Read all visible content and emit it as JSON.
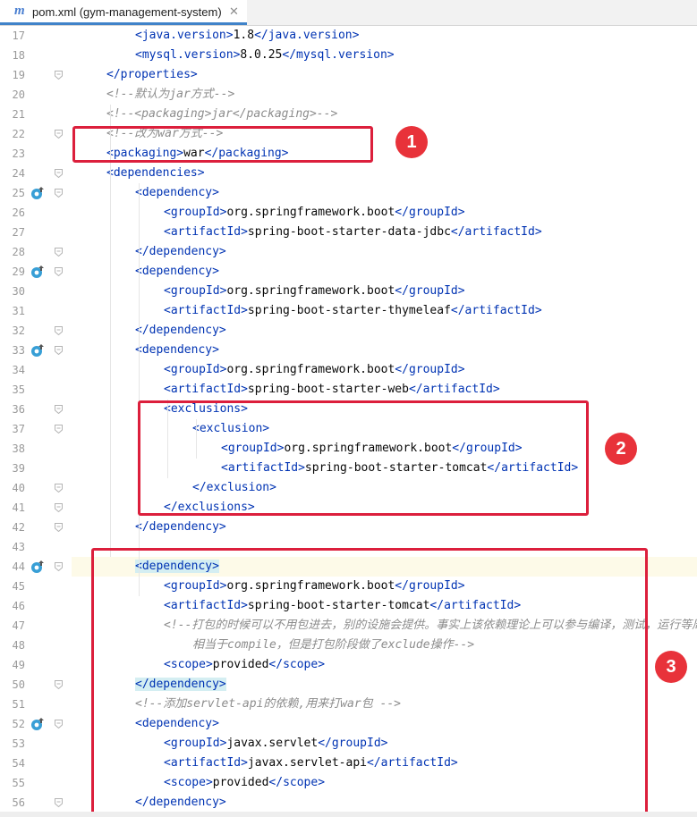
{
  "editor": {
    "tab": {
      "icon": "maven-m-icon",
      "icon_text": "m",
      "label": "pom.xml (gym-management-system)",
      "close": "✕"
    }
  },
  "lines": [
    {
      "no": "17",
      "indent": 2,
      "parts": [
        [
          "t",
          "<java.version>"
        ],
        [
          "x",
          "1.8"
        ],
        [
          "t",
          "</java.version>"
        ]
      ]
    },
    {
      "no": "18",
      "indent": 2,
      "parts": [
        [
          "t",
          "<mysql.version>"
        ],
        [
          "x",
          "8.0.25"
        ],
        [
          "t",
          "</mysql.version>"
        ]
      ]
    },
    {
      "no": "19",
      "indent": 1,
      "parts": [
        [
          "t",
          "</properties>"
        ]
      ]
    },
    {
      "no": "20",
      "indent": 1,
      "parts": [
        [
          "c",
          "<!--默认为jar方式-->"
        ]
      ]
    },
    {
      "no": "21",
      "indent": 1,
      "parts": [
        [
          "c",
          "<!--<packaging>jar</packaging>-->"
        ]
      ]
    },
    {
      "no": "22",
      "indent": 1,
      "parts": [
        [
          "c",
          "<!--改为war方式-->"
        ]
      ]
    },
    {
      "no": "23",
      "indent": 1,
      "parts": [
        [
          "t",
          "<packaging>"
        ],
        [
          "x",
          "war"
        ],
        [
          "t",
          "</packaging>"
        ]
      ]
    },
    {
      "no": "24",
      "indent": 1,
      "parts": [
        [
          "t",
          "<dependencies>"
        ]
      ]
    },
    {
      "no": "25",
      "indent": 2,
      "parts": [
        [
          "t",
          "<dependency>"
        ]
      ]
    },
    {
      "no": "26",
      "indent": 3,
      "parts": [
        [
          "t",
          "<groupId>"
        ],
        [
          "x",
          "org.springframework.boot"
        ],
        [
          "t",
          "</groupId>"
        ]
      ]
    },
    {
      "no": "27",
      "indent": 3,
      "parts": [
        [
          "t",
          "<artifactId>"
        ],
        [
          "x",
          "spring-boot-starter-data-jdbc"
        ],
        [
          "t",
          "</artifactId>"
        ]
      ]
    },
    {
      "no": "28",
      "indent": 2,
      "parts": [
        [
          "t",
          "</dependency>"
        ]
      ]
    },
    {
      "no": "29",
      "indent": 2,
      "parts": [
        [
          "t",
          "<dependency>"
        ]
      ]
    },
    {
      "no": "30",
      "indent": 3,
      "parts": [
        [
          "t",
          "<groupId>"
        ],
        [
          "x",
          "org.springframework.boot"
        ],
        [
          "t",
          "</groupId>"
        ]
      ]
    },
    {
      "no": "31",
      "indent": 3,
      "parts": [
        [
          "t",
          "<artifactId>"
        ],
        [
          "x",
          "spring-boot-starter-thymeleaf"
        ],
        [
          "t",
          "</artifactId>"
        ]
      ]
    },
    {
      "no": "32",
      "indent": 2,
      "parts": [
        [
          "t",
          "</dependency>"
        ]
      ]
    },
    {
      "no": "33",
      "indent": 2,
      "parts": [
        [
          "t",
          "<dependency>"
        ]
      ]
    },
    {
      "no": "34",
      "indent": 3,
      "parts": [
        [
          "t",
          "<groupId>"
        ],
        [
          "x",
          "org.springframework.boot"
        ],
        [
          "t",
          "</groupId>"
        ]
      ]
    },
    {
      "no": "35",
      "indent": 3,
      "parts": [
        [
          "t",
          "<artifactId>"
        ],
        [
          "x",
          "spring-boot-starter-web"
        ],
        [
          "t",
          "</artifactId>"
        ]
      ]
    },
    {
      "no": "36",
      "indent": 3,
      "parts": [
        [
          "t",
          "<exclusions>"
        ]
      ]
    },
    {
      "no": "37",
      "indent": 4,
      "parts": [
        [
          "t",
          "<exclusion>"
        ]
      ]
    },
    {
      "no": "38",
      "indent": 5,
      "parts": [
        [
          "t",
          "<groupId>"
        ],
        [
          "x",
          "org.springframework.boot"
        ],
        [
          "t",
          "</groupId>"
        ]
      ]
    },
    {
      "no": "39",
      "indent": 5,
      "parts": [
        [
          "t",
          "<artifactId>"
        ],
        [
          "x",
          "spring-boot-starter-tomcat"
        ],
        [
          "t",
          "</artifactId>"
        ]
      ]
    },
    {
      "no": "40",
      "indent": 4,
      "parts": [
        [
          "t",
          "</exclusion>"
        ]
      ]
    },
    {
      "no": "41",
      "indent": 3,
      "parts": [
        [
          "t",
          "</exclusions>"
        ]
      ]
    },
    {
      "no": "42",
      "indent": 2,
      "parts": [
        [
          "t",
          "</dependency>"
        ]
      ]
    },
    {
      "no": "43",
      "indent": 0,
      "parts": []
    },
    {
      "no": "44",
      "indent": 2,
      "parts": [
        [
          "h",
          "<dependency>"
        ]
      ]
    },
    {
      "no": "45",
      "indent": 3,
      "parts": [
        [
          "t",
          "<groupId>"
        ],
        [
          "x",
          "org.springframework.boot"
        ],
        [
          "t",
          "</groupId>"
        ]
      ]
    },
    {
      "no": "46",
      "indent": 3,
      "parts": [
        [
          "t",
          "<artifactId>"
        ],
        [
          "x",
          "spring-boot-starter-tomcat"
        ],
        [
          "t",
          "</artifactId>"
        ]
      ]
    },
    {
      "no": "47",
      "indent": 3,
      "parts": [
        [
          "c",
          "<!--打包的时候可以不用包进去，别的设施会提供。事实上该依赖理论上可以参与编译，测试，运行等周期"
        ]
      ]
    },
    {
      "no": "48",
      "indent": 4,
      "parts": [
        [
          "c",
          "相当于compile，但是打包阶段做了exclude操作-->"
        ]
      ]
    },
    {
      "no": "49",
      "indent": 3,
      "parts": [
        [
          "t",
          "<scope>"
        ],
        [
          "x",
          "provided"
        ],
        [
          "t",
          "</scope>"
        ]
      ]
    },
    {
      "no": "50",
      "indent": 2,
      "parts": [
        [
          "h",
          "</dependency>"
        ]
      ]
    },
    {
      "no": "51",
      "indent": 2,
      "parts": [
        [
          "c",
          "<!--添加servlet-api的依赖,用来打war包 -->"
        ]
      ]
    },
    {
      "no": "52",
      "indent": 2,
      "parts": [
        [
          "t",
          "<dependency>"
        ]
      ]
    },
    {
      "no": "53",
      "indent": 3,
      "parts": [
        [
          "t",
          "<groupId>"
        ],
        [
          "x",
          "javax.servlet"
        ],
        [
          "t",
          "</groupId>"
        ]
      ]
    },
    {
      "no": "54",
      "indent": 3,
      "parts": [
        [
          "t",
          "<artifactId>"
        ],
        [
          "x",
          "javax.servlet-api"
        ],
        [
          "t",
          "</artifactId>"
        ]
      ]
    },
    {
      "no": "55",
      "indent": 3,
      "parts": [
        [
          "t",
          "<scope>"
        ],
        [
          "x",
          "provided"
        ],
        [
          "t",
          "</scope>"
        ]
      ]
    },
    {
      "no": "56",
      "indent": 2,
      "parts": [
        [
          "t",
          "</dependency>"
        ]
      ]
    }
  ],
  "gutter_icons": {
    "lines": [
      "25",
      "29",
      "33",
      "44",
      "52"
    ],
    "name": "dependency-override-icon"
  },
  "fold_lines": [
    "19",
    "22",
    "24",
    "25",
    "28",
    "29",
    "32",
    "33",
    "36",
    "37",
    "40",
    "41",
    "42",
    "44",
    "50",
    "52",
    "56"
  ],
  "annotations": [
    {
      "label": "1",
      "name": "annotation-1"
    },
    {
      "label": "2",
      "name": "annotation-2"
    },
    {
      "label": "3",
      "name": "annotation-3"
    }
  ],
  "colors": {
    "tag": "#0033b3",
    "comment": "#8c8c8c",
    "annotation": "#dc1f3c",
    "match_highlight": "#d4eef2"
  }
}
